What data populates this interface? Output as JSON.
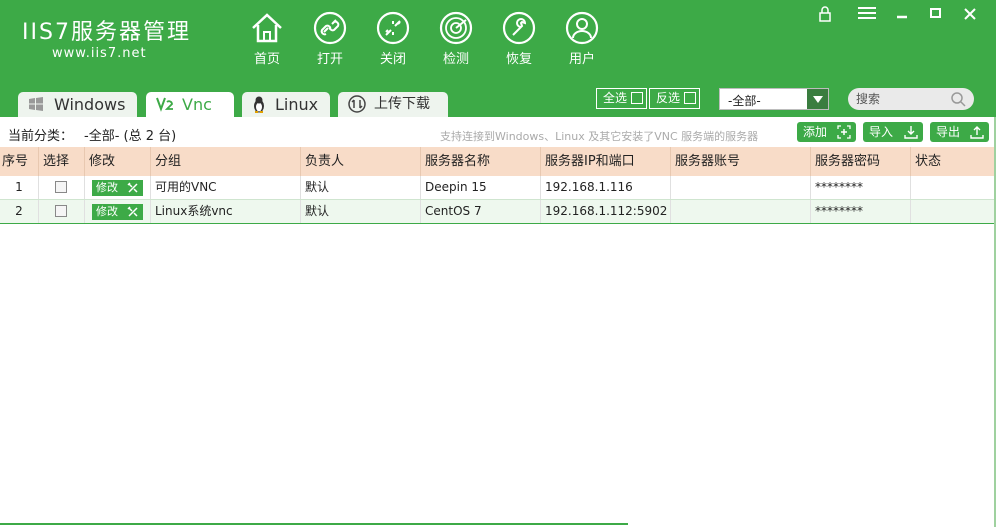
{
  "app": {
    "logo_main": "IIS7服务器管理",
    "logo_sub": "www.iis7.net"
  },
  "nav": [
    {
      "label": "首页",
      "icon": "home-icon"
    },
    {
      "label": "打开",
      "icon": "link-icon"
    },
    {
      "label": "关闭",
      "icon": "broken-link-icon"
    },
    {
      "label": "检测",
      "icon": "radar-icon"
    },
    {
      "label": "恢复",
      "icon": "wrench-icon"
    },
    {
      "label": "用户",
      "icon": "user-icon"
    }
  ],
  "window_controls": [
    "lock-icon",
    "menu-icon",
    "minimize-icon",
    "maximize-icon",
    "close-icon"
  ],
  "tabs": [
    {
      "label": "Windows",
      "icon": "windows-icon",
      "active": false
    },
    {
      "label": "Vnc",
      "icon": "vnc-icon",
      "active": true
    },
    {
      "label": "Linux",
      "icon": "linux-penguin-icon",
      "active": false
    },
    {
      "label": "上传下载",
      "icon": "upload-download-icon",
      "active": false
    }
  ],
  "toolbar": {
    "select_all": "全选",
    "invert_select": "反选",
    "category_selected": "-全部-",
    "search_placeholder": "搜索"
  },
  "infobar": {
    "current_category_label": "当前分类：",
    "current_category_value": "-全部- (总 2 台)",
    "support_text": "支持连接到Windows、Linux 及其它安装了VNC 服务端的服务器",
    "add_label": "添加",
    "import_label": "导入",
    "export_label": "导出"
  },
  "table": {
    "columns": [
      "序号",
      "选择",
      "修改",
      "分组",
      "负责人",
      "服务器名称",
      "服务器IP和端口",
      "服务器账号",
      "服务器密码",
      "状态"
    ],
    "edit_label": "修改",
    "rows": [
      {
        "index": "1",
        "group": "可用的VNC",
        "owner": "默认",
        "name": "Deepin 15",
        "ip": "192.168.1.116",
        "account": "",
        "password": "********",
        "status": ""
      },
      {
        "index": "2",
        "group": "Linux系统vnc",
        "owner": "默认",
        "name": "CentOS 7",
        "ip": "192.168.1.112:5902",
        "account": "",
        "password": "********",
        "status": ""
      }
    ]
  },
  "colors": {
    "brand_green": "#3daa47",
    "header_row": "#f8dcc8",
    "selected_row": "#eef8ee"
  }
}
